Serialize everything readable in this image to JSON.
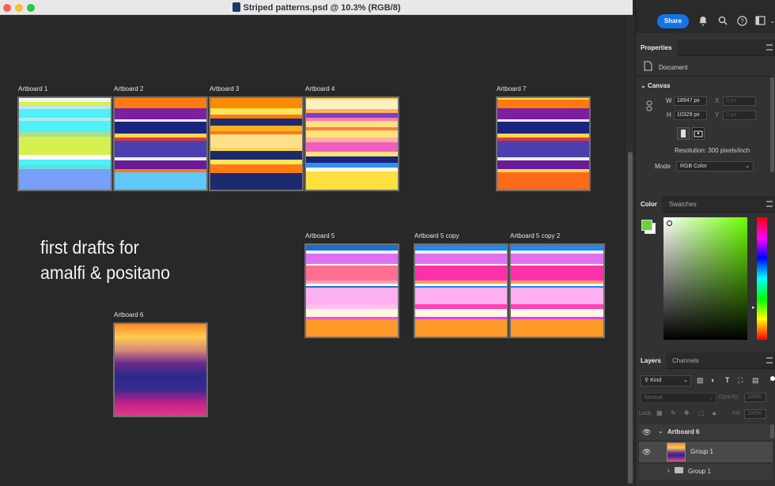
{
  "window": {
    "title": "Striped patterns.psd @ 10.3% (RGB/8)",
    "traffic_lights": [
      "#fe5f57",
      "#febc2e",
      "#28c840"
    ]
  },
  "note": {
    "line1": "first drafts for",
    "line2": "amalfi & positano"
  },
  "artboards": [
    {
      "label": "Artboard 1",
      "stripes": [
        {
          "h": 4,
          "c": "#f2f2f2"
        },
        {
          "h": 5,
          "c": "#d4f24a"
        },
        {
          "h": 3,
          "c": "#b8e8f0"
        },
        {
          "h": 10,
          "c": "#4ff0f8"
        },
        {
          "h": 3,
          "c": "#b0ecec"
        },
        {
          "h": 12,
          "c": "#4ff0f8"
        },
        {
          "h": 5,
          "c": "#a8e090"
        },
        {
          "h": 20,
          "c": "#d6f050"
        },
        {
          "h": 5,
          "c": "#fafafa"
        },
        {
          "h": 6,
          "c": "#4ff0f8"
        },
        {
          "h": 5,
          "c": "#60e0e0"
        },
        {
          "h": 22,
          "c": "#78a0f8"
        }
      ]
    },
    {
      "label": "Artboard 2",
      "stripes": [
        {
          "h": 3,
          "c": "#ff7a10"
        },
        {
          "h": 9,
          "c": "#ff7a10"
        },
        {
          "h": 13,
          "c": "#7c1fa0"
        },
        {
          "h": 2,
          "c": "#f0f0f0"
        },
        {
          "h": 14,
          "c": "#1a237e"
        },
        {
          "h": 5,
          "c": "#ffd54f"
        },
        {
          "h": 3,
          "c": "#e53935"
        },
        {
          "h": 20,
          "c": "#4a3fb0"
        },
        {
          "h": 3,
          "c": "#f0f0f0"
        },
        {
          "h": 10,
          "c": "#6a1b9a"
        },
        {
          "h": 4,
          "c": "#ff7a10"
        },
        {
          "h": 20,
          "c": "#5fc8f8"
        }
      ]
    },
    {
      "label": "Artboard 3",
      "stripes": [
        {
          "h": 12,
          "c": "#ff8a00"
        },
        {
          "h": 7,
          "c": "#ffe45c"
        },
        {
          "h": 5,
          "c": "#ff7a10"
        },
        {
          "h": 8,
          "c": "#1c2a6e"
        },
        {
          "h": 6,
          "c": "#ffb020"
        },
        {
          "h": 4,
          "c": "#ff7a10"
        },
        {
          "h": 16,
          "c": "#ffe08a"
        },
        {
          "h": 3,
          "c": "#ffd54f"
        },
        {
          "h": 10,
          "c": "#1c2a6e"
        },
        {
          "h": 6,
          "c": "#ffe45c"
        },
        {
          "h": 10,
          "c": "#ff7a10"
        },
        {
          "h": 19,
          "c": "#1c2a6e"
        }
      ]
    },
    {
      "label": "Artboard 4",
      "stripes": [
        {
          "h": 2,
          "c": "#ffd24a"
        },
        {
          "h": 10,
          "c": "#fff0c0"
        },
        {
          "h": 4,
          "c": "#ffb060"
        },
        {
          "h": 5,
          "c": "#7e3fc0"
        },
        {
          "h": 3,
          "c": "#ff7ab0"
        },
        {
          "h": 7,
          "c": "#ffe080"
        },
        {
          "h": 3,
          "c": "#ff8040"
        },
        {
          "h": 8,
          "c": "#ffe27a"
        },
        {
          "h": 5,
          "c": "#ffb0a0"
        },
        {
          "h": 10,
          "c": "#f060c0"
        },
        {
          "h": 5,
          "c": "#ffe27a"
        },
        {
          "h": 7,
          "c": "#1a237e"
        },
        {
          "h": 5,
          "c": "#3090f0"
        },
        {
          "h": 4,
          "c": "#fff8e0"
        },
        {
          "h": 19,
          "c": "#ffe040"
        }
      ]
    },
    {
      "label": "Artboard 7",
      "stripes": [
        {
          "h": 2,
          "c": "#ffd54f"
        },
        {
          "h": 10,
          "c": "#ff7a10"
        },
        {
          "h": 13,
          "c": "#7c1fa0"
        },
        {
          "h": 2,
          "c": "#f0f0f0"
        },
        {
          "h": 14,
          "c": "#1a237e"
        },
        {
          "h": 5,
          "c": "#ffd54f"
        },
        {
          "h": 3,
          "c": "#e53935"
        },
        {
          "h": 20,
          "c": "#4a3fb0"
        },
        {
          "h": 3,
          "c": "#f0f0f0"
        },
        {
          "h": 10,
          "c": "#6a1b9a"
        },
        {
          "h": 4,
          "c": "#ffd54f"
        },
        {
          "h": 20,
          "c": "#ff6a1a"
        }
      ]
    },
    {
      "label": "Artboard 5",
      "stripes": [
        {
          "h": 7,
          "c": "#1a70d0"
        },
        {
          "h": 4,
          "c": "#f0f0f0"
        },
        {
          "h": 12,
          "c": "#e070f0"
        },
        {
          "h": 2,
          "c": "#ffffff"
        },
        {
          "h": 18,
          "c": "#ff6f8f"
        },
        {
          "h": 4,
          "c": "#ffa0c0"
        },
        {
          "h": 3,
          "c": "#ffffff"
        },
        {
          "h": 2,
          "c": "#1a70d0"
        },
        {
          "h": 20,
          "c": "#ffb0f0"
        },
        {
          "h": 6,
          "c": "#ffc0f0"
        },
        {
          "h": 10,
          "c": "#fff8e0"
        },
        {
          "h": 3,
          "c": "#ff50d0"
        },
        {
          "h": 21,
          "c": "#ff9a2a"
        }
      ]
    },
    {
      "label": "Artboard 5 copy",
      "stripes": [
        {
          "h": 7,
          "c": "#1e88f0"
        },
        {
          "h": 4,
          "c": "#f0f0f0"
        },
        {
          "h": 12,
          "c": "#e070f0"
        },
        {
          "h": 2,
          "c": "#ffffff"
        },
        {
          "h": 18,
          "c": "#ff30a8"
        },
        {
          "h": 4,
          "c": "#ffa060"
        },
        {
          "h": 3,
          "c": "#ffffff"
        },
        {
          "h": 2,
          "c": "#1e88f0"
        },
        {
          "h": 20,
          "c": "#ffb0f0"
        },
        {
          "h": 6,
          "c": "#ff40b8"
        },
        {
          "h": 10,
          "c": "#fff8e0"
        },
        {
          "h": 3,
          "c": "#e040f0"
        },
        {
          "h": 21,
          "c": "#ff9a2a"
        }
      ]
    },
    {
      "label": "Artboard 5 copy 2",
      "stripes": [
        {
          "h": 7,
          "c": "#1e88f0"
        },
        {
          "h": 4,
          "c": "#f0f0f0"
        },
        {
          "h": 12,
          "c": "#e070f0"
        },
        {
          "h": 2,
          "c": "#ffffff"
        },
        {
          "h": 18,
          "c": "#ff30a8"
        },
        {
          "h": 4,
          "c": "#ffa060"
        },
        {
          "h": 3,
          "c": "#ffffff"
        },
        {
          "h": 2,
          "c": "#1e88f0"
        },
        {
          "h": 20,
          "c": "#ffb0f0"
        },
        {
          "h": 6,
          "c": "#ff40b8"
        },
        {
          "h": 10,
          "c": "#fff8e0"
        },
        {
          "h": 3,
          "c": "#e040f0"
        },
        {
          "h": 21,
          "c": "#ff9a2a"
        }
      ]
    },
    {
      "label": "Artboard 6",
      "gradient": [
        "#ff8a2a",
        "#ffcc50",
        "#d88a7a",
        "#6a2a8a",
        "#2a2a8a",
        "#3a2a90",
        "#c0208a",
        "#e03a8a"
      ]
    }
  ],
  "topbar": {
    "share_label": "Share"
  },
  "properties": {
    "tab": "Properties",
    "document_label": "Document",
    "canvas_header": "Canvas",
    "w_label": "W",
    "w_value": "18947 px",
    "x_label": "X",
    "x_placeholder": "0 px",
    "h_label": "H",
    "h_value": "10329 px",
    "y_label": "Y",
    "y_placeholder": "0 px",
    "resolution": "Resolution: 300 pixels/inch",
    "mode_label": "Mode",
    "mode_value": "RGB Color"
  },
  "color_panel": {
    "tabs": [
      "Color",
      "Swatches"
    ],
    "foreground": "#6ad23c",
    "background": "#ffffff",
    "field_hue": "#6cff00"
  },
  "layers_panel": {
    "tabs": [
      "Layers",
      "Channels"
    ],
    "filter_kind": "Kind",
    "blend_mode": "Normal",
    "opacity_label": "Opacity:",
    "opacity_value": "100%",
    "lock_label": "Lock:",
    "fill_label": "Fill:",
    "fill_value": "100%",
    "items": [
      {
        "name": "Artboard 6"
      },
      {
        "name": "Group 1"
      },
      {
        "name": "Group 1"
      }
    ]
  }
}
